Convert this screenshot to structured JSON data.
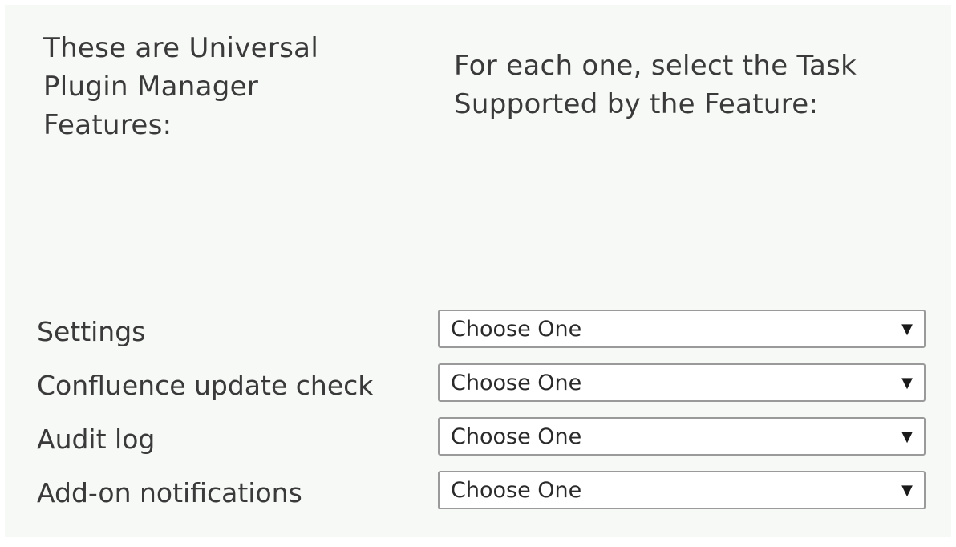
{
  "intro": {
    "left": "These are Universal Plugin Manager Features:",
    "right": "For each one, select the Task Supported by the Feature:"
  },
  "rows": [
    {
      "label": "Settings",
      "select_value": "Choose One",
      "arrow": "▼"
    },
    {
      "label": "Confluence update check",
      "select_value": "Choose One",
      "arrow": "▼"
    },
    {
      "label": "Audit log",
      "select_value": "Choose One",
      "arrow": "▼"
    },
    {
      "label": "Add-on notifications",
      "select_value": "Choose One",
      "arrow": "▼"
    }
  ]
}
